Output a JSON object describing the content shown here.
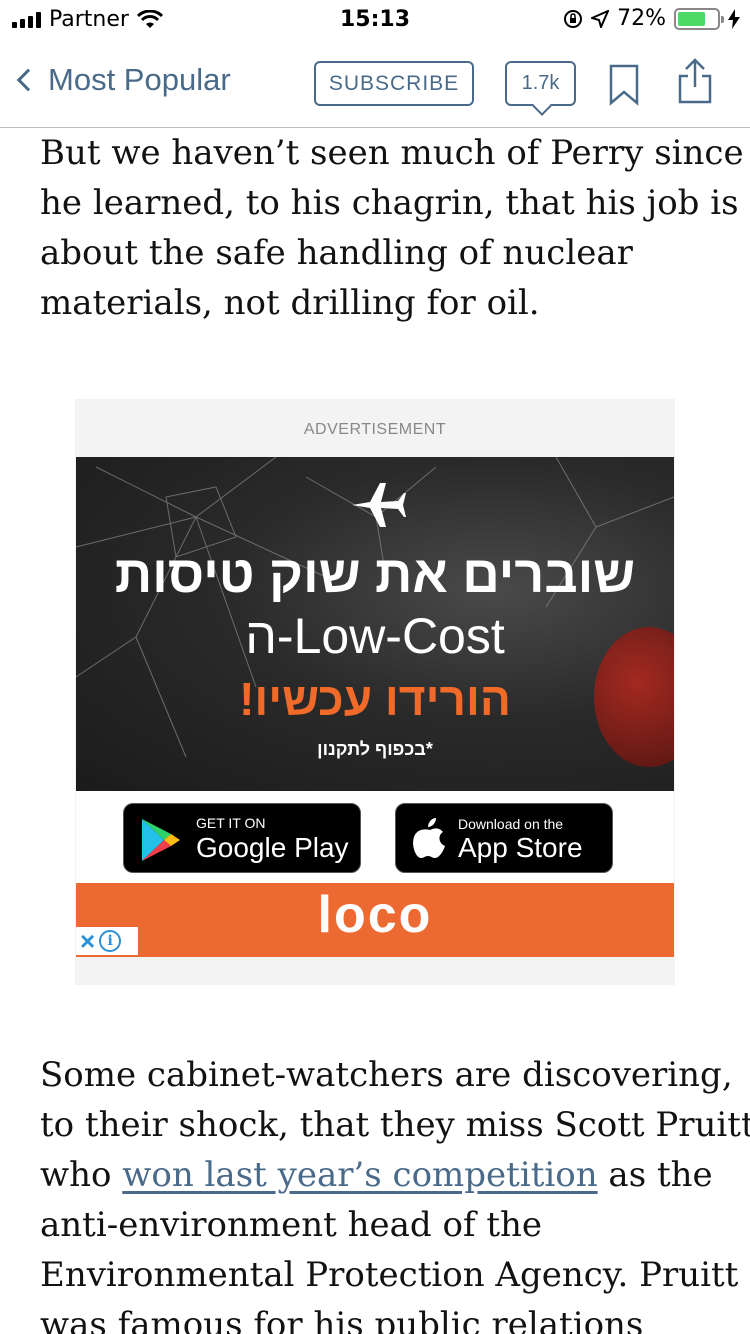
{
  "status_bar": {
    "carrier": "Partner",
    "time": "15:13",
    "battery": "72%",
    "battery_level": 0.72
  },
  "nav": {
    "back_label": "Most Popular",
    "subscribe_label": "SUBSCRIBE",
    "comment_count": "1.7k"
  },
  "article": {
    "para1": [
      "But we haven’t seen much of Perry since",
      "he learned, to his chagrin, that his job is",
      "about the safe handling of nuclear",
      "materials, not drilling for oil."
    ],
    "para2": {
      "line1": "Some cabinet-watchers are discovering,",
      "line2": "to their shock, that they miss Scott Pruitt,",
      "line3_pre": "who ",
      "line3_link": "won last year’s competition",
      "line3_post": " as the",
      "line4": "anti-environment head of the",
      "line5": "Environmental Protection Agency. Pruitt",
      "line6": "was famous for his public relations"
    }
  },
  "ad": {
    "label": "ADVERTISEMENT",
    "headline1": "שוברים את שוק טיסות",
    "headline2": "ה-Low-Cost",
    "cta": "הורידו עכשיו!",
    "disclaimer": "*בכפוף לתקנון",
    "google_play": {
      "small": "GET IT ON",
      "big": "Google Play"
    },
    "app_store": {
      "small": "Download on the",
      "big": "App Store"
    },
    "brand": "loco"
  }
}
